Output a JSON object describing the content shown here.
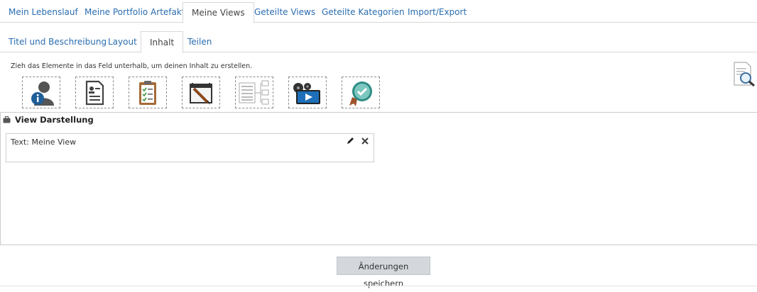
{
  "main_tabs": [
    {
      "label": "Mein Lebenslauf",
      "active": false
    },
    {
      "label": "Meine Portfolio Artefakte",
      "active": false
    },
    {
      "label": "Meine Views",
      "active": true
    },
    {
      "label": "Geteilte Views",
      "active": false
    },
    {
      "label": "Geteilte Kategorien",
      "active": false
    },
    {
      "label": "Import/Export",
      "active": false
    }
  ],
  "sub_tabs": [
    {
      "label": "Titel und Beschreibung",
      "active": false
    },
    {
      "label": "Layout",
      "active": false
    },
    {
      "label": "Inhalt",
      "active": true
    },
    {
      "label": "Teilen",
      "active": false
    }
  ],
  "instruction": "Zieh das Elemente in das Feld unterhalb, um deinen Inhalt zu erstellen.",
  "blocks": [
    {
      "icon": "user-info-icon"
    },
    {
      "icon": "resume-document-icon"
    },
    {
      "icon": "clipboard-checklist-icon"
    },
    {
      "icon": "notes-pencil-icon"
    },
    {
      "icon": "sitemap-list-icon"
    },
    {
      "icon": "media-film-icon"
    },
    {
      "icon": "badge-award-icon"
    }
  ],
  "preview_icon": "page-preview-magnifier-icon",
  "region": {
    "title": "View Darstellung",
    "items": [
      {
        "label": "Text: Meine View"
      }
    ]
  },
  "save_button": "Änderungen speichern",
  "colors": {
    "link": "#2a6db0",
    "border": "#d8d8d8",
    "button_bg": "#d4d8dd"
  }
}
